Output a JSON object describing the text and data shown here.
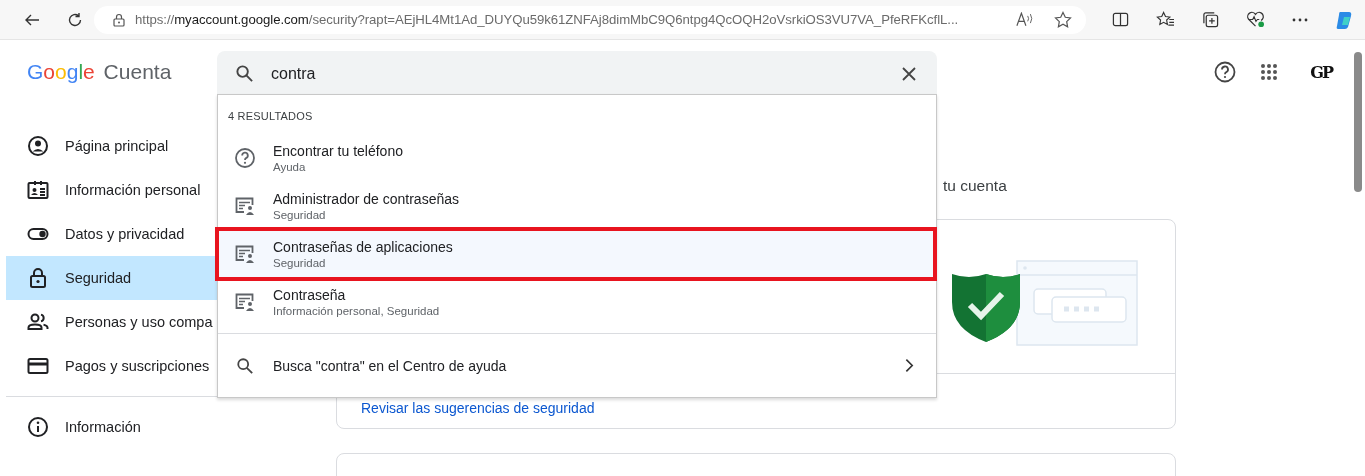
{
  "browser": {
    "url": {
      "scheme": "https://",
      "host": "myaccount.google.com",
      "path": "/security?rapt=AEjHL4Mt1Ad_DUYQu59k61ZNFAj8dimMbC9Q6ntpg4QcOQH2oVsrkiOS3VU7VA_PfeRFKcflL..."
    }
  },
  "header": {
    "logo_word": "Google",
    "product": "Cuenta",
    "avatar": "GP"
  },
  "search": {
    "value": "contra"
  },
  "sidebar": {
    "items": [
      {
        "label": "Página principal",
        "selected": false
      },
      {
        "label": "Información personal",
        "selected": false
      },
      {
        "label": "Datos y privacidad",
        "selected": false
      },
      {
        "label": "Seguridad",
        "selected": true
      },
      {
        "label": "Personas y uso compa",
        "selected": false
      },
      {
        "label": "Pagos y suscripciones",
        "selected": false
      }
    ],
    "footer_items": [
      {
        "label": "Información",
        "selected": false
      }
    ]
  },
  "main": {
    "subtitle_fragment": "tu cuenta",
    "card_link": "Revisar las sugerencias de seguridad"
  },
  "results": {
    "count_label": "4 RESULTADOS",
    "items": [
      {
        "kind": "help",
        "title": "Encontrar tu teléfono",
        "category": "Ayuda",
        "selected": false
      },
      {
        "kind": "page",
        "title": "Administrador de contraseñas",
        "category": "Seguridad",
        "selected": false
      },
      {
        "kind": "page",
        "title": "Contraseñas de aplicaciones",
        "category": "Seguridad",
        "selected": true
      },
      {
        "kind": "page",
        "title": "Contraseña",
        "category": "Información personal, Seguridad",
        "selected": false
      }
    ],
    "help_search": "Busca \"contra\" en el Centro de ayuda"
  }
}
